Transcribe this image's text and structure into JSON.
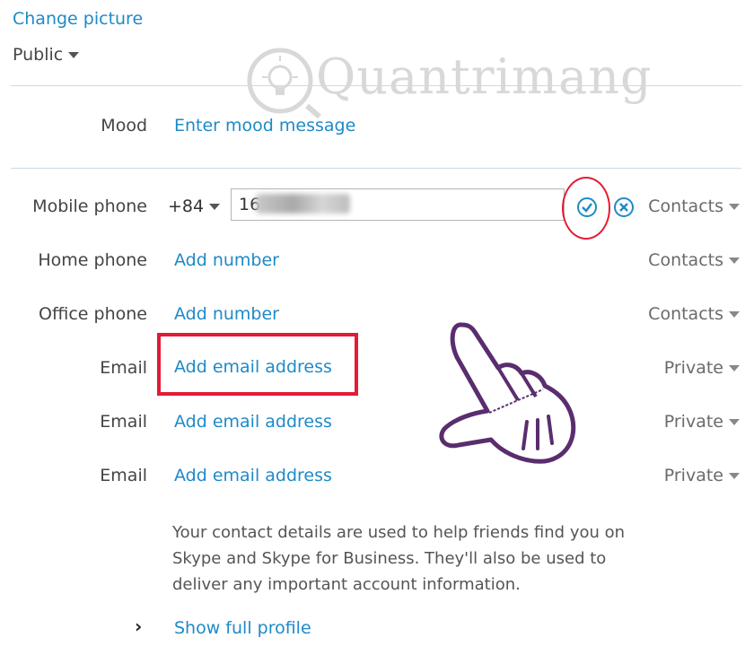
{
  "profile": {
    "change_picture": "Change picture",
    "visibility": "Public"
  },
  "mood": {
    "label": "Mood",
    "placeholder_link": "Enter mood message"
  },
  "mobile": {
    "label": "Mobile phone",
    "country_code": "+84",
    "value": "16",
    "visibility": "Contacts"
  },
  "home_phone": {
    "label": "Home phone",
    "action": "Add number",
    "visibility": "Contacts"
  },
  "office_phone": {
    "label": "Office phone",
    "action": "Add number",
    "visibility": "Contacts"
  },
  "emails": [
    {
      "label": "Email",
      "action": "Add email address",
      "visibility": "Private"
    },
    {
      "label": "Email",
      "action": "Add email address",
      "visibility": "Private"
    },
    {
      "label": "Email",
      "action": "Add email address",
      "visibility": "Private"
    }
  ],
  "info_text": {
    "line1": "Your contact details are used to help friends find you on",
    "line2": "Skype and Skype for Business. They'll also be used to",
    "line3": "deliver any important account information."
  },
  "show_full_profile": "Show full profile",
  "watermark": "Quantrimang",
  "colors": {
    "link": "#1e8ac8",
    "annotation_red": "#e31b35",
    "cursor_purple": "#5a2d6e"
  },
  "icons": [
    "confirm-check-icon",
    "cancel-x-icon",
    "dropdown-caret-icon",
    "chevron-right-icon",
    "hand-pointer-icon",
    "lightbulb-icon"
  ]
}
